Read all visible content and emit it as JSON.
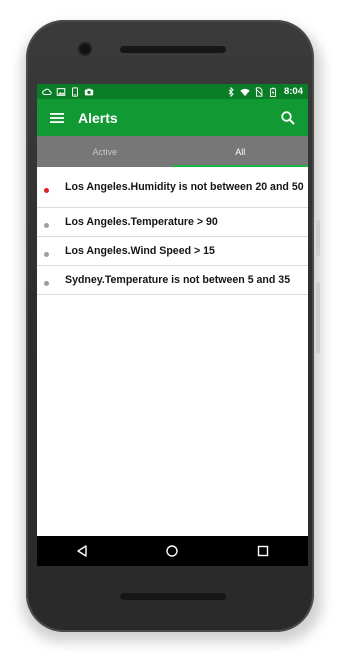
{
  "status_bar": {
    "time": "8:04",
    "left_icons": [
      "cloud-sync-icon",
      "image-icon",
      "phone-icon",
      "camera-icon"
    ],
    "right_icons": [
      "bluetooth-icon",
      "wifi-icon",
      "no-sim-icon",
      "battery-charging-icon"
    ]
  },
  "app_bar": {
    "title": "Alerts",
    "menu_icon": "hamburger-menu-icon",
    "search_icon": "search-icon"
  },
  "tabs": [
    {
      "label": "Active",
      "selected": false
    },
    {
      "label": "All",
      "selected": true
    }
  ],
  "alerts": [
    {
      "text": "Los Angeles.Humidity is not between 20 and 50",
      "indicator_color": "#e02020",
      "active": true
    },
    {
      "text": "Los Angeles.Temperature > 90",
      "indicator_color": "#9e9e9e",
      "active": false
    },
    {
      "text": "Los Angeles.Wind Speed > 15",
      "indicator_color": "#9e9e9e",
      "active": false
    },
    {
      "text": "Sydney.Temperature is not between 5 and 35",
      "indicator_color": "#9e9e9e",
      "active": false
    }
  ],
  "nav_bar": {
    "back_icon": "back-triangle-icon",
    "home_icon": "home-circle-icon",
    "recents_icon": "recents-square-icon"
  },
  "colors": {
    "status_bar": "#0b7d26",
    "app_bar": "#119a34",
    "tab_bar": "#777777",
    "tab_indicator": "#19b33d"
  }
}
